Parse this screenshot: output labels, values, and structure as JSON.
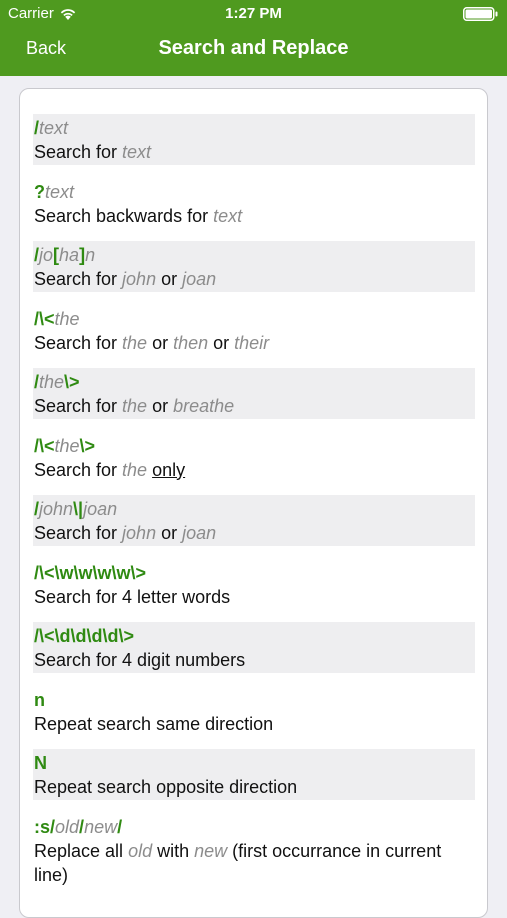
{
  "status": {
    "carrier": "Carrier",
    "time": "1:27 PM"
  },
  "nav": {
    "back_label": "Back",
    "title": "Search and Replace"
  },
  "colors": {
    "header": "#4f9a1f",
    "command": "#2f8a12",
    "placeholder": "#8c8c8c"
  },
  "entries": [
    {
      "cmd": [
        {
          "t": "/",
          "s": "g"
        },
        {
          "t": "text",
          "s": "i"
        }
      ],
      "desc": [
        {
          "t": "Search for "
        },
        {
          "t": "text",
          "s": "i"
        }
      ]
    },
    {
      "cmd": [
        {
          "t": "?",
          "s": "g"
        },
        {
          "t": "text",
          "s": "i"
        }
      ],
      "desc": [
        {
          "t": "Search backwards for "
        },
        {
          "t": "text",
          "s": "i"
        }
      ]
    },
    {
      "cmd": [
        {
          "t": "/",
          "s": "g"
        },
        {
          "t": "jo",
          "s": "i"
        },
        {
          "t": "[",
          "s": "g"
        },
        {
          "t": "ha",
          "s": "i"
        },
        {
          "t": "]",
          "s": "g"
        },
        {
          "t": "n",
          "s": "i"
        }
      ],
      "desc": [
        {
          "t": "Search for "
        },
        {
          "t": "john",
          "s": "i"
        },
        {
          "t": " or "
        },
        {
          "t": "joan",
          "s": "i"
        }
      ]
    },
    {
      "cmd": [
        {
          "t": "/\\<",
          "s": "g"
        },
        {
          "t": "the",
          "s": "i"
        }
      ],
      "desc": [
        {
          "t": "Search for "
        },
        {
          "t": "the",
          "s": "i"
        },
        {
          "t": " or "
        },
        {
          "t": "then",
          "s": "i"
        },
        {
          "t": " or "
        },
        {
          "t": "their",
          "s": "i"
        }
      ]
    },
    {
      "cmd": [
        {
          "t": "/",
          "s": "g"
        },
        {
          "t": "the",
          "s": "i"
        },
        {
          "t": "\\>",
          "s": "g"
        }
      ],
      "desc": [
        {
          "t": "Search for "
        },
        {
          "t": "the",
          "s": "i"
        },
        {
          "t": " or "
        },
        {
          "t": "breathe",
          "s": "i"
        }
      ]
    },
    {
      "cmd": [
        {
          "t": "/\\<",
          "s": "g"
        },
        {
          "t": "the",
          "s": "i"
        },
        {
          "t": "\\>",
          "s": "g"
        }
      ],
      "desc": [
        {
          "t": "Search for "
        },
        {
          "t": "the",
          "s": "i"
        },
        {
          "t": " "
        },
        {
          "t": "only",
          "s": "u"
        }
      ]
    },
    {
      "cmd": [
        {
          "t": "/",
          "s": "g"
        },
        {
          "t": "john",
          "s": "i"
        },
        {
          "t": "\\|",
          "s": "g"
        },
        {
          "t": "joan",
          "s": "i"
        }
      ],
      "desc": [
        {
          "t": "Search for "
        },
        {
          "t": "john",
          "s": "i"
        },
        {
          "t": " or "
        },
        {
          "t": "joan",
          "s": "i"
        }
      ]
    },
    {
      "cmd": [
        {
          "t": "/\\<\\w\\w\\w\\w\\>",
          "s": "g"
        }
      ],
      "desc": [
        {
          "t": "Search for 4 letter words"
        }
      ]
    },
    {
      "cmd": [
        {
          "t": "/\\<\\d\\d\\d\\d\\>",
          "s": "g"
        }
      ],
      "desc": [
        {
          "t": "Search for 4 digit numbers"
        }
      ]
    },
    {
      "cmd": [
        {
          "t": "n",
          "s": "g"
        }
      ],
      "desc": [
        {
          "t": "Repeat search same direction"
        }
      ]
    },
    {
      "cmd": [
        {
          "t": "N",
          "s": "g"
        }
      ],
      "desc": [
        {
          "t": "Repeat search opposite direction"
        }
      ]
    },
    {
      "cmd": [
        {
          "t": ":s/",
          "s": "g"
        },
        {
          "t": "old",
          "s": "i"
        },
        {
          "t": "/",
          "s": "g"
        },
        {
          "t": "new",
          "s": "i"
        },
        {
          "t": "/",
          "s": "g"
        }
      ],
      "desc": [
        {
          "t": "Replace all "
        },
        {
          "t": "old",
          "s": "i"
        },
        {
          "t": " with "
        },
        {
          "t": "new",
          "s": "i"
        },
        {
          "t": " (first occurrance in current line)"
        }
      ]
    }
  ]
}
